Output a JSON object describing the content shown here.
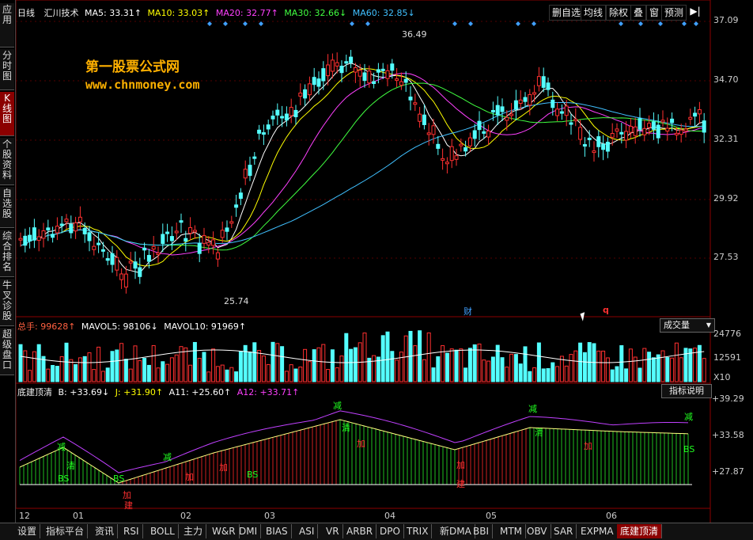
{
  "sidebar": {
    "items": [
      {
        "label": "应用",
        "active": false
      },
      {
        "label": "分时图",
        "active": false
      },
      {
        "label": "K线图",
        "active": true
      },
      {
        "label": "个股资料",
        "active": false
      },
      {
        "label": "自选股",
        "active": false
      },
      {
        "label": "综合排名",
        "active": false
      },
      {
        "label": "牛叉诊股",
        "active": false
      },
      {
        "label": "超级盘口",
        "active": false
      }
    ]
  },
  "header": {
    "period": "日线",
    "stock_name": "汇川技术",
    "ma5": "MA5: 33.31↑",
    "ma10": "MA10: 33.03↑",
    "ma20": "MA20: 32.77↑",
    "ma30": "MA30: 32.66↓",
    "ma60": "MA60: 32.85↓"
  },
  "toolbar": {
    "buttons": [
      "删自选",
      "均线",
      "除权",
      "叠",
      "窗",
      "预测"
    ]
  },
  "watermark": {
    "line1": "第一股票公式网",
    "line2": "www.chnmoney.com"
  },
  "price_axis": {
    "labels": [
      "37.09",
      "34.70",
      "32.31",
      "29.92",
      "27.53"
    ]
  },
  "annotations": {
    "high": "36.49",
    "low": "25.74",
    "cai": "财",
    "q": "q"
  },
  "volume": {
    "title": "总手: 99628↑",
    "mavol5": "MAVOL5: 98106↓",
    "mavol10": "MAVOL10: 91969↑",
    "select_label": "成交量",
    "axis": [
      "24776",
      "12591",
      "X10"
    ]
  },
  "indicator": {
    "name": "底建顶清",
    "b": "B: +33.69↓",
    "j": "J: +31.90↑",
    "a11": "A11: +25.60↑",
    "a12": "A12: +33.71↑",
    "help_label": "指标说明",
    "axis": [
      "+39.29",
      "+33.58",
      "+27.87"
    ],
    "signals": {
      "jian": "减",
      "qing": "清",
      "jia": "加",
      "jian2": "建",
      "bs": "BS"
    }
  },
  "x_axis": {
    "labels": [
      "12",
      "01",
      "02",
      "03",
      "04",
      "05",
      "06"
    ]
  },
  "bottom_tabs": [
    {
      "label": "设置",
      "active": false
    },
    {
      "label": "指标平台",
      "active": false
    },
    {
      "label": "资讯",
      "active": false
    },
    {
      "label": "RSI",
      "active": false
    },
    {
      "label": "BOLL",
      "active": false
    },
    {
      "label": "主力",
      "active": false
    },
    {
      "label": "W&R",
      "active": false
    },
    {
      "label": "DMI",
      "active": false
    },
    {
      "label": "BIAS",
      "active": false
    },
    {
      "label": "ASI",
      "active": false
    },
    {
      "label": "VR",
      "active": false
    },
    {
      "label": "ARBR",
      "active": false
    },
    {
      "label": "DPO",
      "active": false
    },
    {
      "label": "TRIX",
      "active": false
    },
    {
      "label": "新DMA",
      "active": false
    },
    {
      "label": "BBI",
      "active": false
    },
    {
      "label": "MTM",
      "active": false
    },
    {
      "label": "OBV",
      "active": false
    },
    {
      "label": "SAR",
      "active": false
    },
    {
      "label": "EXPMA",
      "active": false
    },
    {
      "label": "底建顶清",
      "active": true
    }
  ],
  "colors": {
    "up": "#ff3030",
    "down": "#54ffff",
    "ma5": "#ffffff",
    "ma10": "#ffff00",
    "ma20": "#ff40ff",
    "ma30": "#40ff40",
    "ma60": "#40c0ff"
  }
}
